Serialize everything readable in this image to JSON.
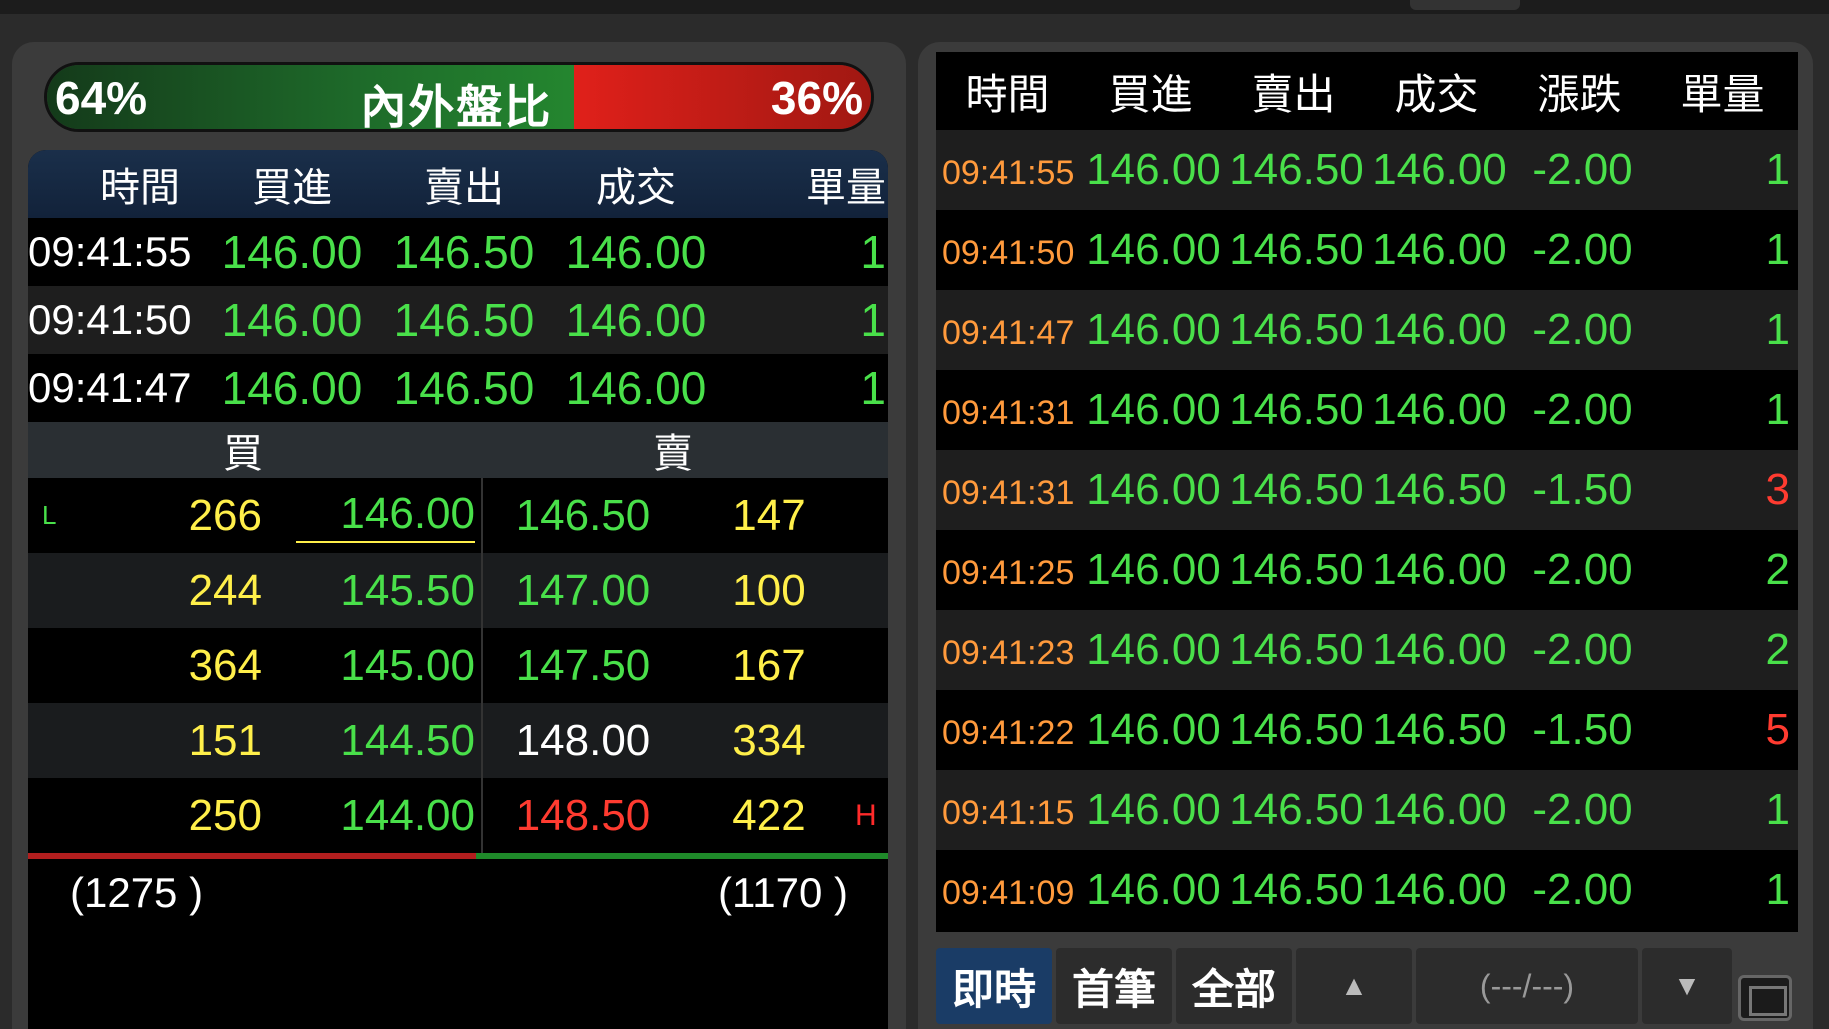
{
  "ratio": {
    "title": "內外盤比",
    "left_pct": "64%",
    "right_pct": "36%"
  },
  "left": {
    "headers": [
      "時間",
      "買進",
      "賣出",
      "成交",
      "單量"
    ],
    "trades": [
      {
        "time": "09:41:55",
        "bid": "146.00",
        "ask": "146.50",
        "price": "146.00",
        "qty": "1"
      },
      {
        "time": "09:41:50",
        "bid": "146.00",
        "ask": "146.50",
        "price": "146.00",
        "qty": "1"
      },
      {
        "time": "09:41:47",
        "bid": "146.00",
        "ask": "146.50",
        "price": "146.00",
        "qty": "1"
      }
    ],
    "buy_label": "買",
    "sell_label": "賣",
    "book": [
      {
        "mark": "L",
        "bid_vol": "266",
        "bid": "146.00",
        "ask": "146.50",
        "ask_vol": "147",
        "hmark": ""
      },
      {
        "mark": "",
        "bid_vol": "244",
        "bid": "145.50",
        "ask": "147.00",
        "ask_vol": "100",
        "hmark": ""
      },
      {
        "mark": "",
        "bid_vol": "364",
        "bid": "145.00",
        "ask": "147.50",
        "ask_vol": "167",
        "hmark": ""
      },
      {
        "mark": "",
        "bid_vol": "151",
        "bid": "144.50",
        "ask": "148.00",
        "ask_vol": "334",
        "hmark": ""
      },
      {
        "mark": "",
        "bid_vol": "250",
        "bid": "144.00",
        "ask": "148.50",
        "ask_vol": "422",
        "hmark": "H"
      }
    ],
    "buy_total": "(1275 )",
    "sell_total": "(1170 )"
  },
  "right": {
    "headers": [
      "時間",
      "買進",
      "賣出",
      "成交",
      "漲跌",
      "單量"
    ],
    "trades": [
      {
        "time": "09:41:55",
        "bid": "146.00",
        "ask": "146.50",
        "price": "146.00",
        "change": "-2.00",
        "qty": "1"
      },
      {
        "time": "09:41:50",
        "bid": "146.00",
        "ask": "146.50",
        "price": "146.00",
        "change": "-2.00",
        "qty": "1"
      },
      {
        "time": "09:41:47",
        "bid": "146.00",
        "ask": "146.50",
        "price": "146.00",
        "change": "-2.00",
        "qty": "1"
      },
      {
        "time": "09:41:31",
        "bid": "146.00",
        "ask": "146.50",
        "price": "146.00",
        "change": "-2.00",
        "qty": "1"
      },
      {
        "time": "09:41:31",
        "bid": "146.00",
        "ask": "146.50",
        "price": "146.50",
        "change": "-1.50",
        "qty": "3"
      },
      {
        "time": "09:41:25",
        "bid": "146.00",
        "ask": "146.50",
        "price": "146.00",
        "change": "-2.00",
        "qty": "2"
      },
      {
        "time": "09:41:23",
        "bid": "146.00",
        "ask": "146.50",
        "price": "146.00",
        "change": "-2.00",
        "qty": "2"
      },
      {
        "time": "09:41:22",
        "bid": "146.00",
        "ask": "146.50",
        "price": "146.50",
        "change": "-1.50",
        "qty": "5"
      },
      {
        "time": "09:41:15",
        "bid": "146.00",
        "ask": "146.50",
        "price": "146.00",
        "change": "-2.00",
        "qty": "1"
      },
      {
        "time": "09:41:09",
        "bid": "146.00",
        "ask": "146.50",
        "price": "146.00",
        "change": "-2.00",
        "qty": "1"
      }
    ],
    "footer": {
      "realtime": "即時",
      "first": "首筆",
      "all": "全部",
      "up": "▲",
      "pager": "(---/---)",
      "down": "▼"
    }
  },
  "colors": {
    "up_red": "#ff3b30",
    "down_green": "#49e04a",
    "volume_yellow": "#ffef4a",
    "time_orange": "#ff9a3c"
  }
}
